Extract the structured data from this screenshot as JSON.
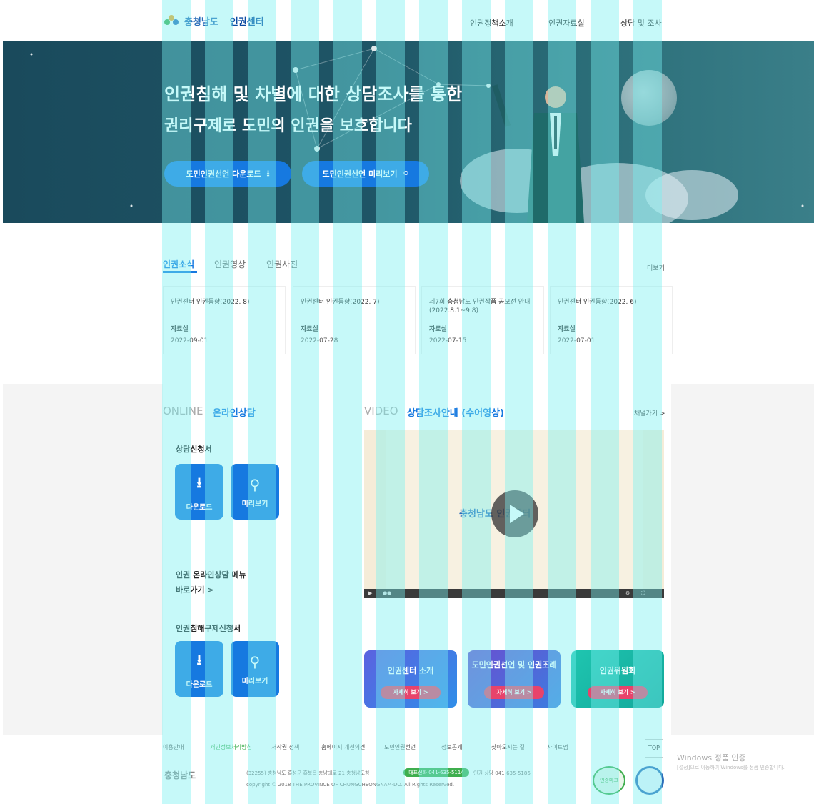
{
  "header": {
    "logo_text": "충청남도",
    "logo_sub": "인권센터",
    "nav": [
      "인권정책소개",
      "인권자료실",
      "상담 및 조사"
    ]
  },
  "hero": {
    "line1": "인권침해 및 차별에 대한 상담조사를 통한",
    "line2": "권리구제로 도민의 인권을 보호합니다",
    "btn_download": "도민인권선언 다운로드",
    "btn_preview": "도민인권선언 미리보기"
  },
  "news": {
    "tabs": [
      "인권소식",
      "인권영상",
      "인권사진"
    ],
    "more": "더보기",
    "cards": [
      {
        "title": "인권센터 인권동향(2022. 8)",
        "category": "자료실",
        "date": "2022-09-01"
      },
      {
        "title": "인권센터 인권동향(2022. 7)",
        "category": "자료실",
        "date": "2022-07-28"
      },
      {
        "title": "제7회 충청남도 인권작품 공모전 안내(2022.8.1~9.8)",
        "category": "자료실",
        "date": "2022-07-15"
      },
      {
        "title": "인권센터 인권동향(2022. 6)",
        "category": "자료실",
        "date": "2022-07-01"
      }
    ]
  },
  "online": {
    "label_en": "ONLINE",
    "label_ko": "온라인상담",
    "form1_title": "상담신청서",
    "download": "다운로드",
    "preview": "미리보기",
    "link_line1": "인권 온라인상담 메뉴",
    "link_line2": "바로가기 >",
    "form2_title": "인권침해구제신청서"
  },
  "video": {
    "label_en": "VIDEO",
    "label_ko": "상담조사안내 (수어영상)",
    "more": "채널가기 >",
    "logo_text": "충청남도 인권센터"
  },
  "promo": [
    {
      "title": "인권센터 소개",
      "btn": "자세히 보기 >",
      "color": "#4a6fd8"
    },
    {
      "title": "도민인권선언 및 인권조례",
      "btn": "자세히 보기 >",
      "color": "#5b56c8"
    },
    {
      "title": "인권위원회",
      "btn": "자세히 보기 >",
      "color": "#14b8a6"
    }
  ],
  "footer": {
    "links": [
      "이용안내",
      "개인정보처리방침",
      "저작권 정책",
      "홈페이지 개선의견",
      "도민인권선언",
      "정보공개",
      "찾아오시는 길",
      "사이트맵"
    ],
    "top": "TOP",
    "logo": "충청남도",
    "address": "(32255) 충청남도 홍성군 홍북읍 충남대로 21 충청남도청",
    "tel": "대표전화 041-635-5114",
    "tel2": "인권 상담 041-635-5186",
    "copyright": "copyright © 2018 THE PROVINCE OF CHUNGCHEONGNAM-DO. All Rights Reserved.",
    "badge": "인증마크"
  },
  "windows": {
    "line1": "Windows 정품 인증",
    "line2": "[설정]으로 이동하여 Windows를 정품 인증합니다."
  }
}
